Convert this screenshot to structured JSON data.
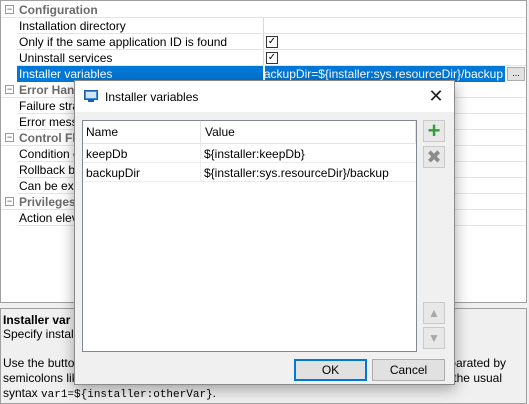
{
  "grid": {
    "config_title": "Configuration",
    "install_dir": "Installation directory",
    "same_app_id": "Only if the same application ID is found",
    "uninstall_services": "Uninstall services",
    "installer_vars": "Installer variables",
    "installer_vars_value": "}; backupDir=${installer:sys.resourceDir}/backup",
    "ellipsis": "...",
    "error_hand": "Error Hand",
    "failure_stra": "Failure stra",
    "error_messa": "Error messa",
    "control_fl": "Control Fl",
    "condition_e": "Condition e",
    "rollback_ba": "Rollback ba",
    "can_be_exe": "Can be exe",
    "privileges": "Privileges",
    "action_elev": "Action elev",
    "checked_glyph": "✓",
    "collapse_glyph": "−"
  },
  "desc": {
    "title": "Installer var",
    "subtitle": "Specify installe",
    "line1_left": "Use the button",
    "line1_right": "parated by",
    "line2_left": "semicolons like",
    "line2_right": "the usual",
    "line3_prefix": "syntax ",
    "line3_code": "var1=${installer:otherVar}",
    "line3_suffix": "."
  },
  "dialog": {
    "title": "Installer variables",
    "close_glyph": "✕",
    "columns": [
      "Name",
      "Value"
    ],
    "rows": [
      {
        "name": "keepDb",
        "value": "${installer:keepDb}"
      },
      {
        "name": "backupDir",
        "value": "${installer:sys.resourceDir}/backup"
      }
    ],
    "add_glyph": "+",
    "remove_glyph": "✖",
    "up_glyph": "▲",
    "down_glyph": "▼",
    "ok_label": "OK",
    "cancel_label": "Cancel"
  }
}
